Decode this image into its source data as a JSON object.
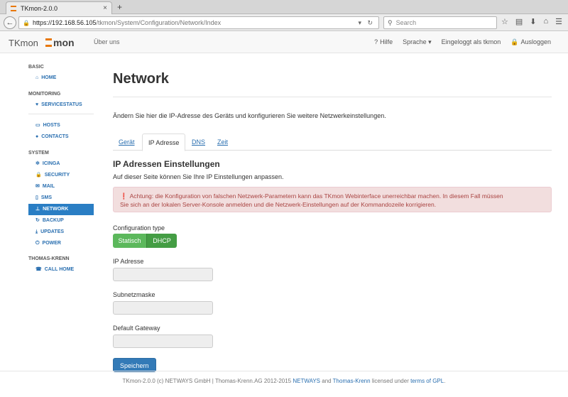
{
  "browser": {
    "tab_title": "TKmon-2.0.0",
    "tab_close": "×",
    "new_tab": "+",
    "back": "←",
    "url_host": "https://192.168.56.105",
    "url_path": "/tkmon/System/Configuration/Network/Index",
    "url_right_icons": "▾ ↻",
    "search_placeholder": "Search",
    "nav_icons": [
      "☆",
      "▤",
      "⬇",
      "⌂",
      "☰"
    ]
  },
  "header": {
    "brand": "TKmon",
    "logo_text": "mon",
    "about": "Über uns",
    "help": "Hilfe",
    "help_icon": "?",
    "language": "Sprache ▾",
    "logged_in": "Eingeloggt als tkmon",
    "logout": "Ausloggen",
    "logout_icon": "🔒"
  },
  "sidebar": {
    "sections": {
      "basic": "BASIC",
      "monitoring": "MONITORING",
      "system": "SYSTEM",
      "thomas_krenn": "THOMAS-KRENN"
    },
    "items": {
      "home": {
        "icon": "⌂",
        "label": "HOME"
      },
      "servicestatus": {
        "icon": "♥",
        "label": "SERVICESTATUS"
      },
      "hosts": {
        "icon": "▭",
        "label": "HOSTS"
      },
      "contacts": {
        "icon": "●",
        "label": "CONTACTS"
      },
      "icinga": {
        "icon": "✲",
        "label": "ICINGA"
      },
      "security": {
        "icon": "🔒",
        "label": "SECURITY"
      },
      "mail": {
        "icon": "✉",
        "label": "MAIL"
      },
      "sms": {
        "icon": "▯",
        "label": "SMS"
      },
      "network": {
        "icon": "⊥",
        "label": "NETWORK"
      },
      "backup": {
        "icon": "↻",
        "label": "BACKUP"
      },
      "updates": {
        "icon": "⤓",
        "label": "UPDATES"
      },
      "power": {
        "icon": "⏻",
        "label": "POWER"
      },
      "call_home": {
        "icon": "☎",
        "label": "CALL HOME"
      }
    }
  },
  "main": {
    "title": "Network",
    "intro": "Ändern Sie hier die IP-Adresse des Geräts und konfigurieren Sie weitere Netzwerkeinstellungen.",
    "tabs": [
      "Gerät",
      "IP Adresse",
      "DNS",
      "Zeit"
    ],
    "subhead": "IP Adressen Einstellungen",
    "subtext": "Auf dieser Seite können Sie Ihre IP Einstellungen anpassen.",
    "alert_icon": "❗",
    "alert_line1": "Achtung: die Konfiguration von falschen Netzwerk-Parametern kann das TKmon Webinterface unerreichbar machen. In diesem Fall müssen",
    "alert_line2": "Sie sich an der lokalen Server-Konsole anmelden und die Netzwerk-Einstellungen auf der Kommandozeile korrigieren.",
    "config_type_label": "Configuration type",
    "config_options": [
      "Statisch",
      "DHCP"
    ],
    "selected_option": "DHCP",
    "ip_label": "IP Adresse",
    "ip_value": "",
    "subnet_label": "Subnetzmaske",
    "subnet_value": "",
    "gateway_label": "Default Gateway",
    "gateway_value": "",
    "save": "Speichern"
  },
  "footer": {
    "text1": "TKmon-2.0.0 (c) NETWAYS GmbH | Thomas-Krenn.AG 2012-2015 ",
    "link1": "NETWAYS",
    "text2": " and ",
    "link2": "Thomas-Krenn",
    "text3": " licensed under ",
    "link3": "terms of GPL",
    "text4": "."
  },
  "colors": {
    "accent": "#2a7ec4",
    "logo_orange": "#e8780a",
    "toggle_green": "#5cb85c",
    "alert_bg": "#f2dede"
  }
}
